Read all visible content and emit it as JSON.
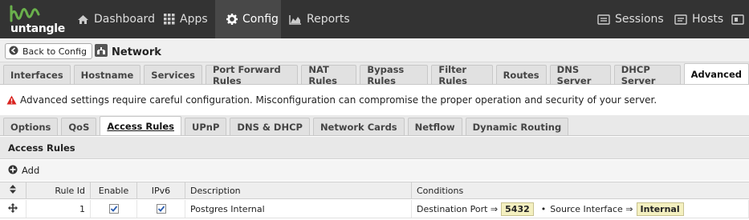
{
  "brand": {
    "name": "untangle"
  },
  "nav": {
    "dashboard": "Dashboard",
    "apps": "Apps",
    "config": "Config",
    "reports": "Reports",
    "sessions": "Sessions",
    "hosts": "Hosts"
  },
  "header": {
    "back_label": "Back to Config",
    "title": "Network"
  },
  "main_tabs": [
    "Interfaces",
    "Hostname",
    "Services",
    "Port Forward Rules",
    "NAT Rules",
    "Bypass Rules",
    "Filter Rules",
    "Routes",
    "DNS Server",
    "DHCP Server",
    "Advanced"
  ],
  "main_tabs_active": "Advanced",
  "warning": "Advanced settings require careful configuration. Misconfiguration can compromise the proper operation and security of your server.",
  "sub_tabs": [
    "Options",
    "QoS",
    "Access Rules",
    "UPnP",
    "DNS & DHCP",
    "Network Cards",
    "Netflow",
    "Dynamic Routing"
  ],
  "sub_tabs_active": "Access Rules",
  "panel": {
    "title": "Access Rules",
    "add_label": "Add"
  },
  "grid": {
    "columns": {
      "rule_id": "Rule Id",
      "enable": "Enable",
      "ipv6": "IPv6",
      "description": "Description",
      "conditions": "Conditions"
    },
    "rows": [
      {
        "rule_id": "1",
        "enable": true,
        "ipv6": true,
        "description": "Postgres Internal",
        "cond1_label": "Destination Port ⇒",
        "cond1_value": "5432",
        "sep": "•",
        "cond2_label": "Source Interface ⇒",
        "cond2_value": "Internal"
      }
    ]
  },
  "colors": {
    "topbar": "#333333",
    "logo_green": "#6ab04c",
    "warn_red": "#d9231f",
    "pill_bg": "#f4f0c0"
  }
}
